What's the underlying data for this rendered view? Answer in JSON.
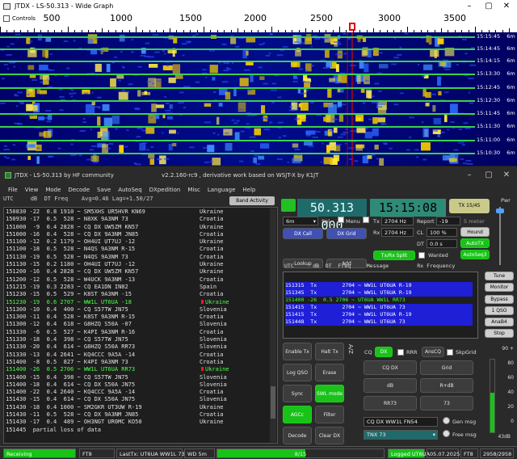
{
  "wide_graph": {
    "window_title": "JTDX - LS-50.313 - Wide Graph",
    "controls_label": "Controls",
    "freq_ticks": [
      "500",
      "1000",
      "1500",
      "2000",
      "2500",
      "3000",
      "3500"
    ],
    "timestamps": [
      {
        "time": "15:15:45",
        "band": "6m"
      },
      {
        "time": "15:14:45",
        "band": "6m"
      },
      {
        "time": "15:14:15",
        "band": "6m"
      },
      {
        "time": "15:13:30",
        "band": "6m"
      },
      {
        "time": "15:12:45",
        "band": "6m"
      },
      {
        "time": "15:12:30",
        "band": "6m"
      },
      {
        "time": "15:11:45",
        "band": "6m"
      },
      {
        "time": "15:11:30",
        "band": "6m"
      },
      {
        "time": "15:11:00",
        "band": "6m"
      },
      {
        "time": "15:10:30",
        "band": "6m"
      }
    ]
  },
  "main_window": {
    "title_left": "JTDX - LS-50.313   by HF community",
    "title_mid": "v2.2.160-rc9 , derivative work based on WSJT-X by K1JT",
    "menu": [
      "File",
      "View",
      "Mode",
      "Decode",
      "Save",
      "AutoSeq",
      "DXpedition",
      "Misc",
      "Language",
      "Help"
    ]
  },
  "band_activity": {
    "header": "UTC     dB  DT Freq    Avg=0.46 Lag=+1.50/27",
    "button": "Band Activity",
    "rows": [
      {
        "text": "150830 -22  0.8 1910 ~ SM5XHS UR5HVR KN69",
        "country": "Ukraine"
      },
      {
        "text": "150930 -17  0.5  528 ~ N8XK 9A3NM 73",
        "country": "Croatia"
      },
      {
        "text": "151000  -9  0.4 2828 ~ CQ DX UW5ZM KN57",
        "country": "Ukraine"
      },
      {
        "text": "151000 -16  0.4  528 ~ CQ DX 9A3NM JN85",
        "country": "Croatia"
      },
      {
        "text": "151100 -12  0.2 1179 ~ OH4UI UT7UJ -12",
        "country": "Ukraine"
      },
      {
        "text": "151100 -18  0.5  528 ~ N4QS 9A3NM R-15",
        "country": "Croatia"
      },
      {
        "text": "151130 -19  0.5  528 ~ N4QS 9A3NM 73",
        "country": "Croatia"
      },
      {
        "text": "151130 -15  0.2 1180 ~ OH4UI UT7UJ -12",
        "country": "Ukraine"
      },
      {
        "text": "151200 -16  0.4 2828 ~ CQ DX UW5ZM KN57",
        "country": "Ukraine"
      },
      {
        "text": "151200 -12  0.5  528 ~ W4UCK 9A3NM -13",
        "country": "Croatia"
      },
      {
        "text": "151215 -19  0.3 2283 ~ CQ EA1DN IN82",
        "country": "Spain"
      },
      {
        "text": "151230 -15  0.5  529 ~ K8ST 9A3NM -15",
        "country": "Croatia"
      },
      {
        "text": "151230 -19  0.6 2707 ~ WW1L UT6UA -18",
        "country": "Ukraine",
        "green": true,
        "red": true
      },
      {
        "text": "151300 -10  0.4  400 ~ CQ S57TW JN75",
        "country": "Slovenia"
      },
      {
        "text": "151300 -11  0.4  528 ~ K8ST 9A3NM R-15",
        "country": "Croatia"
      },
      {
        "text": "151300 -12  0.4  618 ~ G8HZQ S50A -07",
        "country": "Slovenia"
      },
      {
        "text": "151330  -6  0.5  527 ~ K4PI 9A3NM R-16",
        "country": "Croatia"
      },
      {
        "text": "151330 -18  0.4  398 ~ CQ S57TW JN75",
        "country": "Slovenia"
      },
      {
        "text": "151330 -20  0.4  614 ~ G8HZQ S50A RR73",
        "country": "Slovenia"
      },
      {
        "text": "151330 -13  0.4 2641 ~ KQ4CCC 9A5A -14",
        "country": "Croatia"
      },
      {
        "text": "151400  -8  0.5  827 ~ K4PI 9A3NM 73",
        "country": "Croatia"
      },
      {
        "text": "151400 -26  0.5 2706 ~ WW1L UT6UA RR73",
        "country": "Ukraine",
        "green": true,
        "red": true
      },
      {
        "text": "151400 -15  0.4  398 ~ CQ S57TW JN75",
        "country": "Slovenia"
      },
      {
        "text": "151400 -18  0.4  614 ~ CQ DX S50A JN75",
        "country": "Slovenia"
      },
      {
        "text": "151400 -22  0.4 2640 ~ KQ4CCC 9A5A -14",
        "country": "Croatia"
      },
      {
        "text": "151430 -15  0.4  614 ~ CQ DX S50A JN75",
        "country": "Slovenia"
      },
      {
        "text": "151430 -18  0.4 1000 ~ SM2GKR UT3UW R-19",
        "country": "Ukraine"
      },
      {
        "text": "151430 -11  0.5  528 ~ CQ DX 9A3NM JN85",
        "country": "Croatia"
      },
      {
        "text": "151430 -17  0.4  489 ~ OH3NGT UR0MC KO50",
        "country": "Ukraine"
      },
      {
        "text": "151445  partial loss of data",
        "country": ""
      }
    ]
  },
  "controls": {
    "frequency": "50.313 000",
    "time": "15:15:08",
    "tx_badge": "TX 15/45",
    "band": "6m",
    "spl_label": "Spl",
    "menu_label": "Menu",
    "tx_freq_label": "Tx",
    "tx_freq": "2704 Hz",
    "report_label": "Report",
    "report_value": "-19",
    "meter_label": "5 meter",
    "rx_freq_label": "Rx",
    "rx_freq": "2704 Hz",
    "cl_label": "CL",
    "cl_value": "100 %",
    "dt_label": "DT",
    "dt_value": "0.0 s",
    "dx_call_btn": "DX Call",
    "dx_grid_btn": "DX Grid",
    "txrx_split_btn": "Tx/Rx Split",
    "wanted_label": "Wanted",
    "hound_btn": "Hound",
    "autotx_btn": "AutoTX",
    "autoseq_btn": "AutoSeq3",
    "lookup_btn": "Lookup",
    "add_btn": "Add",
    "rx_header": "UTC      dB  DT  Freq     Message         Rx Frequency",
    "rx_rows": [
      {
        "text": "151315  Tx        2704 ~ WW1L UT6UA R-19",
        "hl": false
      },
      {
        "text": "151345  Tx        2704 ~ WW1L UT6UA R-19",
        "hl": false
      },
      {
        "text": "151400 -26  0.5 2706 ~ UT6UA WW1L RR73",
        "hl": true
      },
      {
        "text": "151415  Tx        2704 ~ WW1L UT6UA 73",
        "hl": false
      },
      {
        "text": "151415  Tx        2704 ~ WW1L UT6UA R-19",
        "hl": false
      },
      {
        "text": "151448  Tx        2704 ~ WW1L UT6UA 73",
        "hl": false
      }
    ],
    "pwr_label": "Pwr",
    "tune_btn": "Tune",
    "monitor_btn": "Monitor",
    "bypass_btn": "Bypass",
    "qso_btn": "1 QSO",
    "anab_btn": "AnaB4",
    "stop_btn": "Stop",
    "enable_tx_btn": "Enable Tx",
    "halt_tx_btn": "Halt Tx",
    "log_qso_btn": "Log QSO",
    "erase_btn": "Erase",
    "sync_btn": "Sync",
    "swl_btn": "SWL mode",
    "agcc_btn": "AGCc",
    "filter_btn": "Filter",
    "decode_btn": "Decode",
    "clear_dx_btn": "Clear DX",
    "cq_label": "CQ",
    "dx_btn": "DX",
    "rrr_label": "RRR",
    "anscq_btn": "AnsCQ",
    "skpgrid_label": "SkpGrid",
    "cq_dx_btn": "CQ DX",
    "grid_btn": "Grid",
    "db_btn": "dB",
    "rdb_btn": "R+dB",
    "rr73_btn": "RR73",
    "r73_btn": "73",
    "gen_msg_value": "CQ DX WW1L FN54",
    "gen_msg_label": "Gen msg",
    "free_msg_value": "TNX 73",
    "free_msg_label": "Free msg",
    "az_label": "A/Z",
    "meter_ticks": [
      "90 +",
      "80",
      "60",
      "40",
      "20",
      "0"
    ],
    "meter_db": "43dB"
  },
  "status_bar": {
    "receiving": "Receiving",
    "mode": "FT8",
    "last_tx": "LastTx: UT6UA WW1L 73",
    "wd": "WD 5m",
    "progress_text": "8/15",
    "progress_fraction": 0.53,
    "logged": "Logged UT6UA",
    "date": "05.07.2025",
    "mode2": "FT8",
    "counter": "2958/2958"
  }
}
